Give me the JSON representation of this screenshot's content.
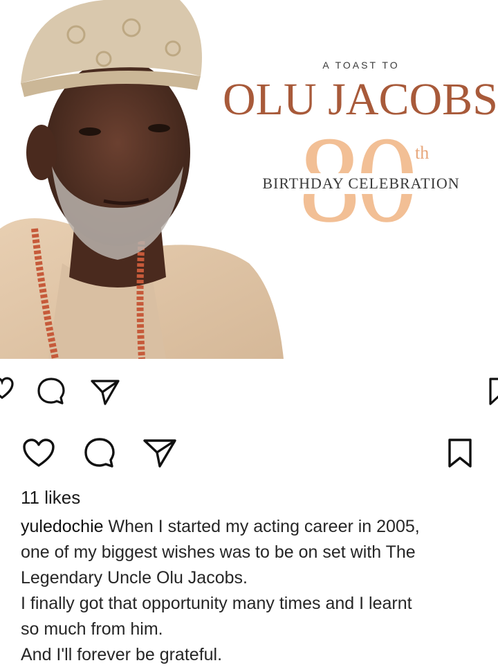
{
  "post_image": {
    "tagline": "A TOAST TO",
    "headline": "OLU JACOBS",
    "big_number": "80",
    "ordinal": "th",
    "celebration": "BIRTHDAY CELEBRATION"
  },
  "icons": {
    "like": "heart-icon",
    "comment": "comment-icon",
    "share": "send-icon",
    "save": "bookmark-icon"
  },
  "post": {
    "likes": "11 likes",
    "username": "yuledochie",
    "caption_lines": [
      "When I started my acting career in 2005,",
      "one of my biggest wishes was to be on set with The",
      "Legendary Uncle Olu Jacobs.",
      "I finally got that opportunity many times and I learnt",
      "so much from him.",
      "And I'll forever be grateful."
    ]
  }
}
